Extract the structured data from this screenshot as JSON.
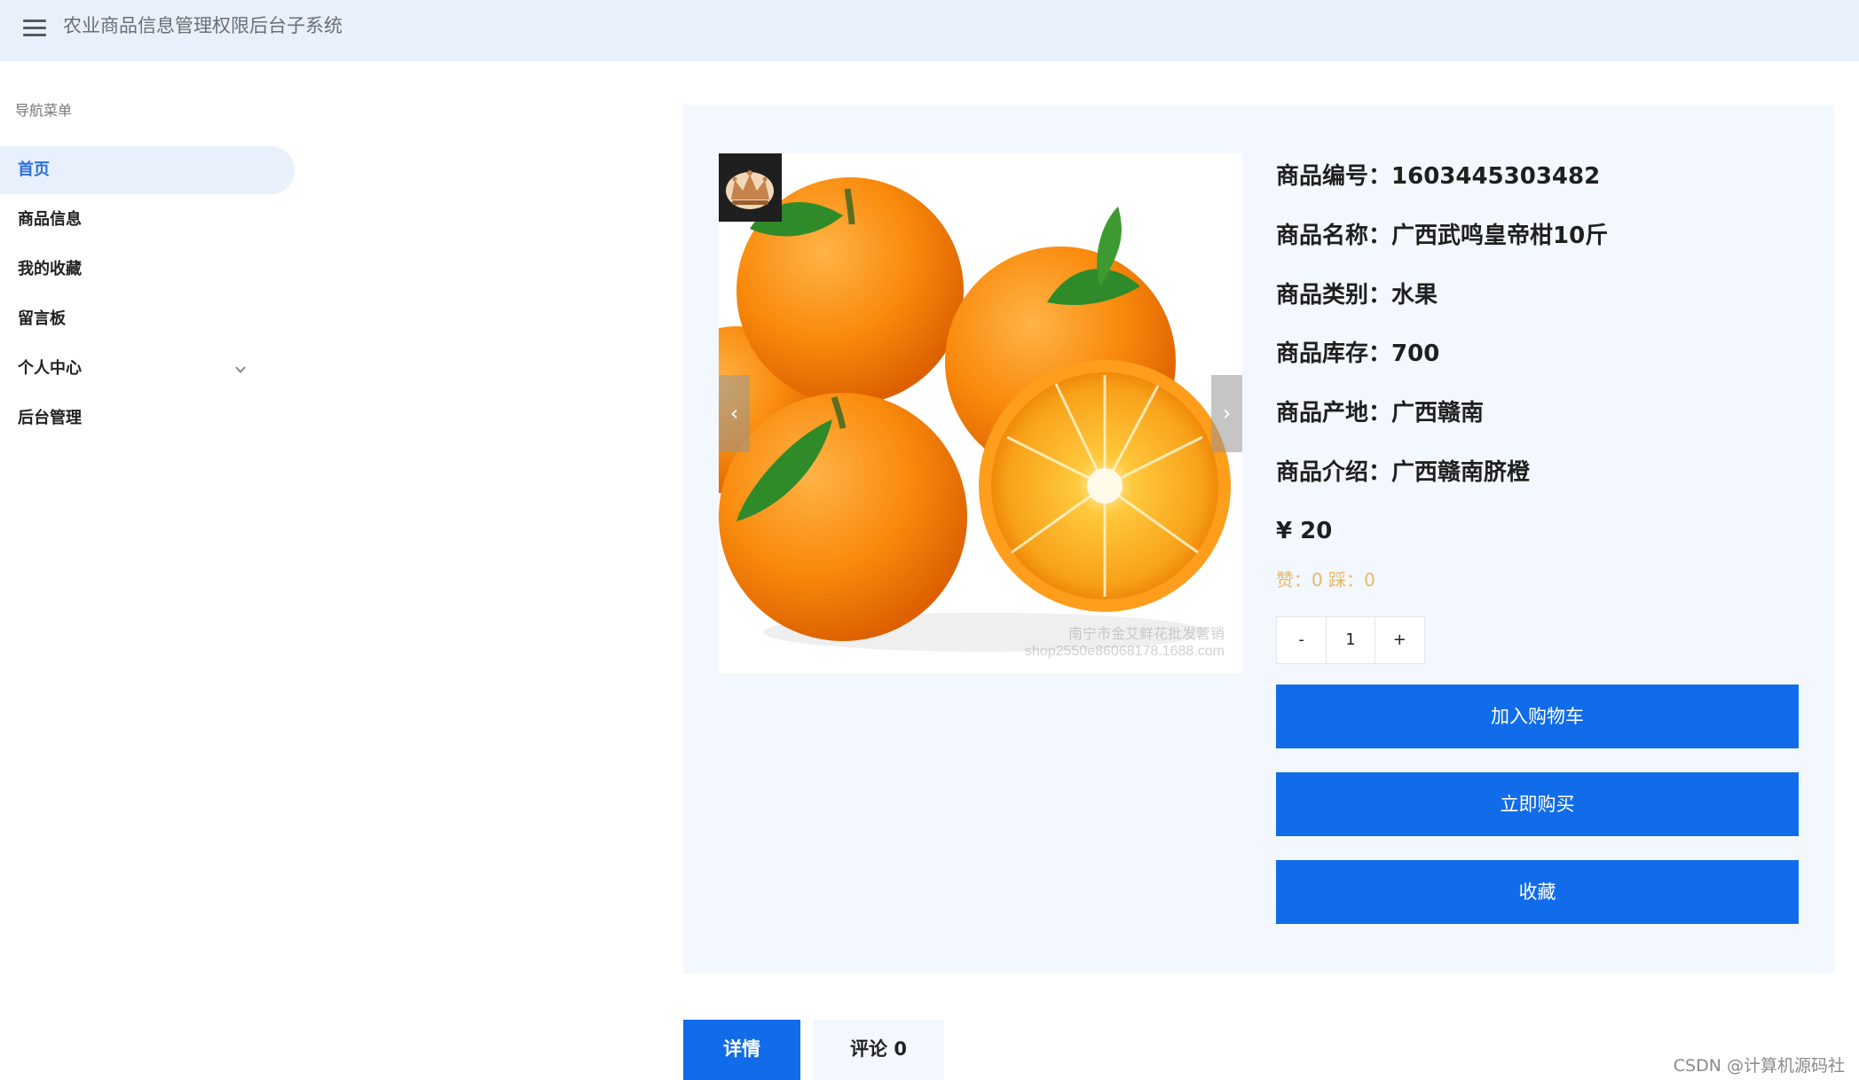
{
  "header": {
    "title": "农业商品信息管理权限后台子系统",
    "menu_icon": "menu-icon"
  },
  "sidebar": {
    "heading": "导航菜单",
    "items": [
      {
        "label": "首页",
        "active": true
      },
      {
        "label": "商品信息",
        "active": false
      },
      {
        "label": "我的收藏",
        "active": false
      },
      {
        "label": "留言板",
        "active": false
      },
      {
        "label": "个人中心",
        "active": false,
        "expandable": true
      },
      {
        "label": "后台管理",
        "active": false
      }
    ]
  },
  "product": {
    "image_watermark": [
      "南宁市金艾鲜花批发营销",
      "shop2550e86068178.1688.com"
    ],
    "badge_icon": "crown-icon",
    "fields": [
      {
        "label": "商品编号：",
        "value": "1603445303482"
      },
      {
        "label": "商品名称：",
        "value": "广西武鸣皇帝柑10斤"
      },
      {
        "label": "商品类别：",
        "value": "水果"
      },
      {
        "label": "商品库存：",
        "value": "700"
      },
      {
        "label": "商品产地：",
        "value": "广西赣南"
      },
      {
        "label": "商品介绍：",
        "value": "广西赣南脐橙"
      }
    ],
    "price": "¥ 20",
    "likes_text": "赞：0 踩：0",
    "quantity": {
      "minus": "-",
      "value": "1",
      "plus": "+"
    },
    "buttons": {
      "add_to_cart": "加入购物车",
      "buy_now": "立即购买",
      "favorite": "收藏"
    }
  },
  "tabs": {
    "detail": "详情",
    "comments": "评论 0"
  },
  "footer": {
    "watermark": "CSDN @计算机源码社"
  },
  "colors": {
    "primary": "#116ce9",
    "header_bg": "#e8f0fc",
    "panel_bg": "#f3f8fe",
    "likes": "#e6b86a"
  }
}
